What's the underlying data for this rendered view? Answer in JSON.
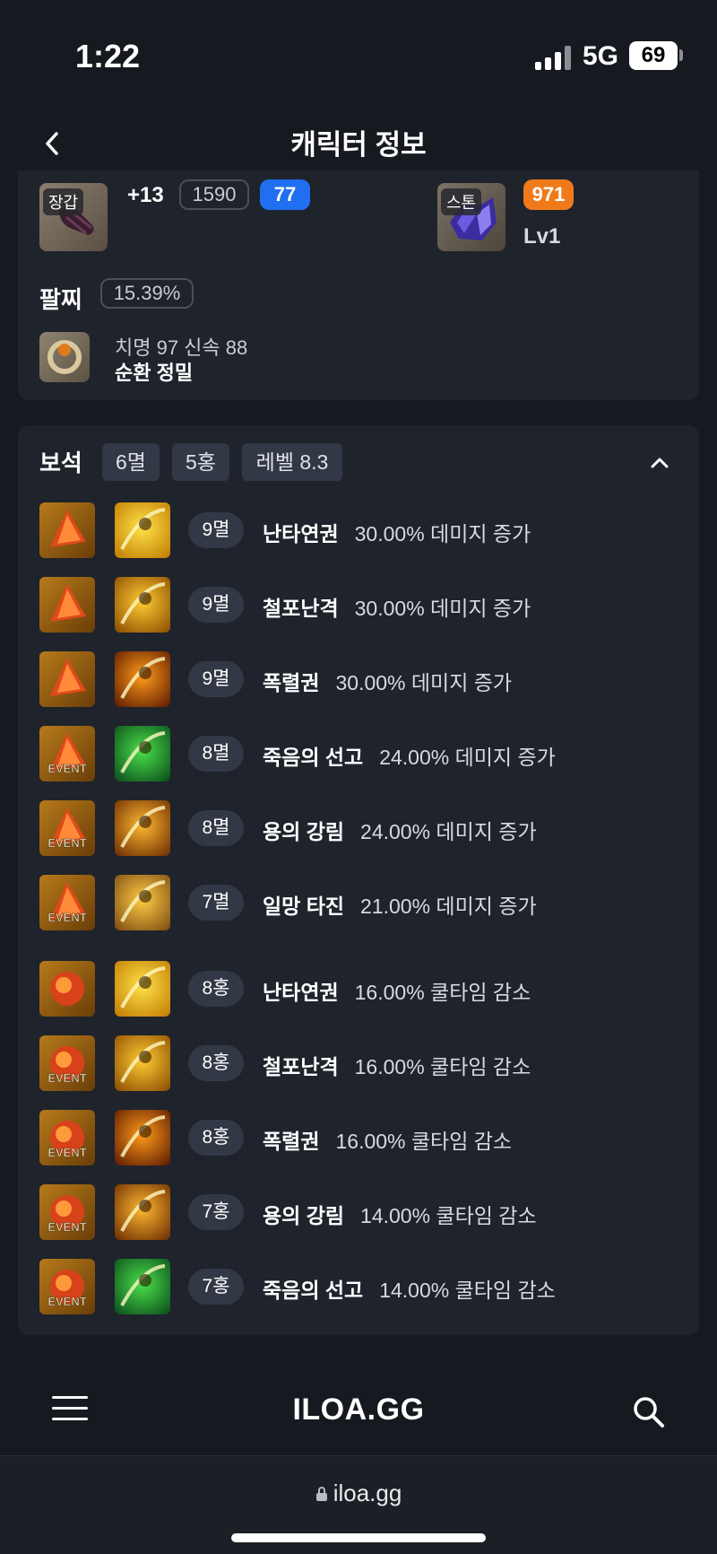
{
  "status_bar": {
    "time": "1:22",
    "network": "5G",
    "battery": "69"
  },
  "header": {
    "title": "캐릭터 정보"
  },
  "equipment": {
    "glove": {
      "tag": "장갑",
      "enhance": "+13",
      "item_level": "1590",
      "quality": "77"
    },
    "stone": {
      "tag": "스톤",
      "quality": "971",
      "level": "Lv1"
    }
  },
  "bracelet": {
    "label": "팔찌",
    "percent": "15.39%",
    "stats": "치명 97  신속 88",
    "effects": "순환  정밀"
  },
  "gems": {
    "title": "보석",
    "chips": [
      "6멸",
      "5홍",
      "레벨 8.3"
    ],
    "rows": [
      {
        "level": "9멸",
        "skill": "난타연권",
        "effect": "30.00% 데미지 증가",
        "event": false
      },
      {
        "level": "9멸",
        "skill": "철포난격",
        "effect": "30.00% 데미지 증가",
        "event": false
      },
      {
        "level": "9멸",
        "skill": "폭렬권",
        "effect": "30.00% 데미지 증가",
        "event": false
      },
      {
        "level": "8멸",
        "skill": "죽음의 선고",
        "effect": "24.00% 데미지 증가",
        "event": true
      },
      {
        "level": "8멸",
        "skill": "용의 강림",
        "effect": "24.00% 데미지 증가",
        "event": true
      },
      {
        "level": "7멸",
        "skill": "일망 타진",
        "effect": "21.00% 데미지 증가",
        "event": true
      },
      {
        "level": "8홍",
        "skill": "난타연권",
        "effect": "16.00% 쿨타임 감소",
        "event": false
      },
      {
        "level": "8홍",
        "skill": "철포난격",
        "effect": "16.00% 쿨타임 감소",
        "event": true
      },
      {
        "level": "8홍",
        "skill": "폭렬권",
        "effect": "16.00% 쿨타임 감소",
        "event": true
      },
      {
        "level": "7홍",
        "skill": "용의 강림",
        "effect": "14.00% 쿨타임 감소",
        "event": true
      },
      {
        "level": "7홍",
        "skill": "죽음의 선고",
        "effect": "14.00% 쿨타임 감소",
        "event": true
      }
    ],
    "event_label": "EVENT"
  },
  "bottom_nav": {
    "logo": "ILOA.GG"
  },
  "browser": {
    "url": "iloa.gg"
  },
  "colors": {
    "background": "#16191f",
    "card": "#1f232c",
    "quality_blue": "#1f6ff0",
    "quality_orange": "#f07a1a",
    "chip": "#323845"
  },
  "icons": [
    "back-chevron-icon",
    "collapse-chevron-icon",
    "menu-icon",
    "search-icon",
    "lock-icon"
  ]
}
